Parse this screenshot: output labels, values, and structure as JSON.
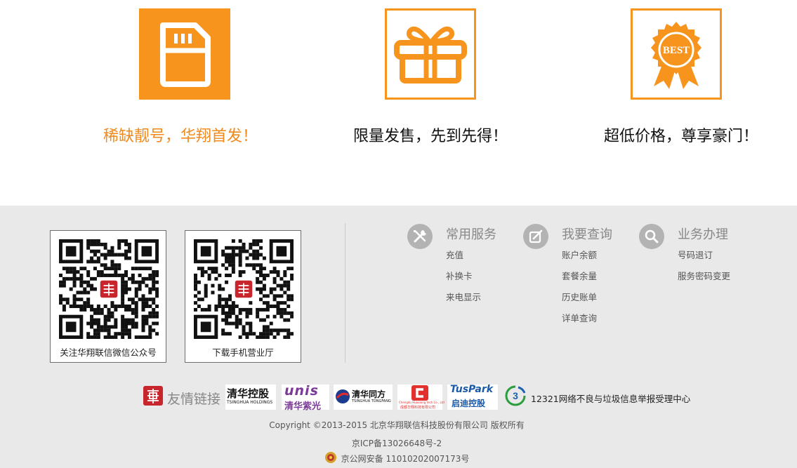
{
  "features": [
    {
      "icon": "sim-card-icon",
      "caption": "稀缺靓号，华翔首发！",
      "caption_color": "#f08a1c"
    },
    {
      "icon": "gift-icon",
      "caption": "限量发售，先到先得！",
      "caption_color": "#111111"
    },
    {
      "icon": "best-badge-icon",
      "caption": "超低价格，尊享豪门！",
      "caption_color": "#111111",
      "badge_text": "BEST"
    }
  ],
  "qr_codes": [
    {
      "label": "关注华翔联信微信公众号"
    },
    {
      "label": "下载手机营业厅"
    }
  ],
  "services": [
    {
      "title": "常用服务",
      "icon": "tools-icon",
      "links": [
        "充值",
        "补换卡",
        "来电显示"
      ]
    },
    {
      "title": "我要查询",
      "icon": "edit-icon",
      "links": [
        "账户余额",
        "套餐余量",
        "历史账单",
        "详单查询"
      ]
    },
    {
      "title": "业务办理",
      "icon": "search-icon",
      "links": [
        "号码退订",
        "服务密码变更"
      ]
    }
  ],
  "partners": {
    "label": "友情链接",
    "logos": [
      {
        "name": "tsinghua-holdings-logo",
        "cn": "清华控股",
        "en": "TSINGHUA HOLDINGS"
      },
      {
        "name": "unis-logo",
        "en": "unis",
        "cn": "清华紫光"
      },
      {
        "name": "tongfang-logo",
        "cn": "清华同方",
        "en": "TSINGHUA TONGFANG"
      },
      {
        "name": "chengdu-logo",
        "en": "Chengdu Huaxiang tech Co., Ltd",
        "cn": "成都华翔科技有限公司"
      },
      {
        "name": "tuspark-logo",
        "en": "TusPark",
        "cn": "启迪控股"
      }
    ],
    "report_text": "12321网络不良与垃圾信息举报受理中心"
  },
  "footer": {
    "copyright": "Copyright ©2013-2015 北京华翔联信科技股份有限公司 版权所有",
    "icp": "京ICP备13026648号-2",
    "police": "京公网安备 11010202007173号"
  },
  "colors": {
    "accent": "#f7941d",
    "footer_bg": "#e9e9e9",
    "icon_gray": "#b3b3b3"
  }
}
